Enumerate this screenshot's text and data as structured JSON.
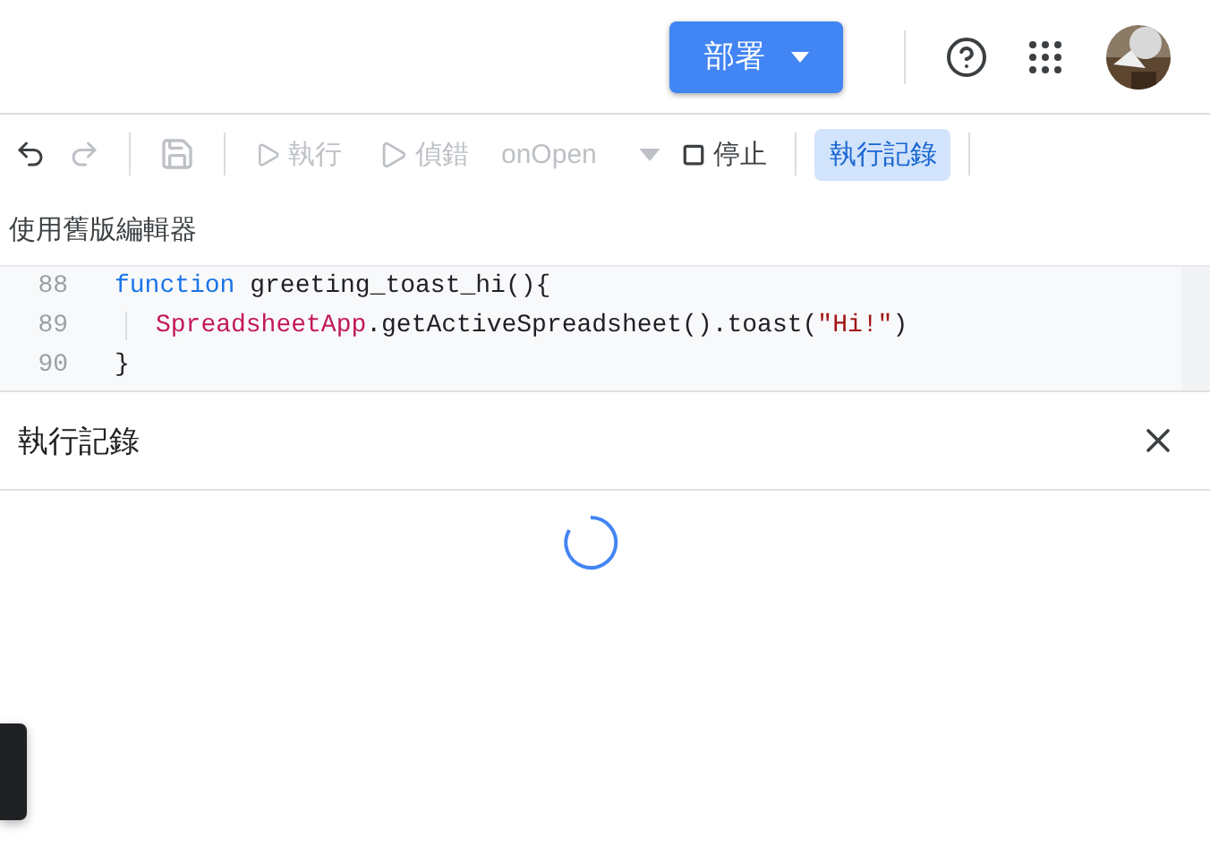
{
  "header": {
    "deploy_button": "部署"
  },
  "toolbar": {
    "undo": {
      "disabled": false
    },
    "redo": {
      "disabled": true
    },
    "save": {
      "disabled": true
    },
    "run": {
      "label": "執行",
      "disabled": true
    },
    "debug": {
      "label": "偵錯",
      "disabled": true
    },
    "function_select": {
      "value": "onOpen",
      "disabled": true
    },
    "stop": {
      "label": "停止",
      "disabled": false
    },
    "execution_log": {
      "label": "執行記錄",
      "selected": true
    }
  },
  "legacy_editor_link": "使用舊版編輯器",
  "code": {
    "lines": [
      {
        "number": "88",
        "tokens": [
          {
            "kind": "keyword",
            "text": "function"
          },
          {
            "kind": "plain",
            "text": " greeting_toast_hi(){"
          }
        ]
      },
      {
        "number": "89",
        "indent": true,
        "tokens": [
          {
            "kind": "class",
            "text": "SpreadsheetApp"
          },
          {
            "kind": "plain",
            "text": ".getActiveSpreadsheet().toast("
          },
          {
            "kind": "string",
            "text": "\"Hi!\""
          },
          {
            "kind": "plain",
            "text": ")"
          }
        ]
      },
      {
        "number": "90",
        "tokens": [
          {
            "kind": "plain",
            "text": "}"
          }
        ]
      }
    ]
  },
  "log_panel": {
    "title": "執行記錄",
    "loading": true
  }
}
